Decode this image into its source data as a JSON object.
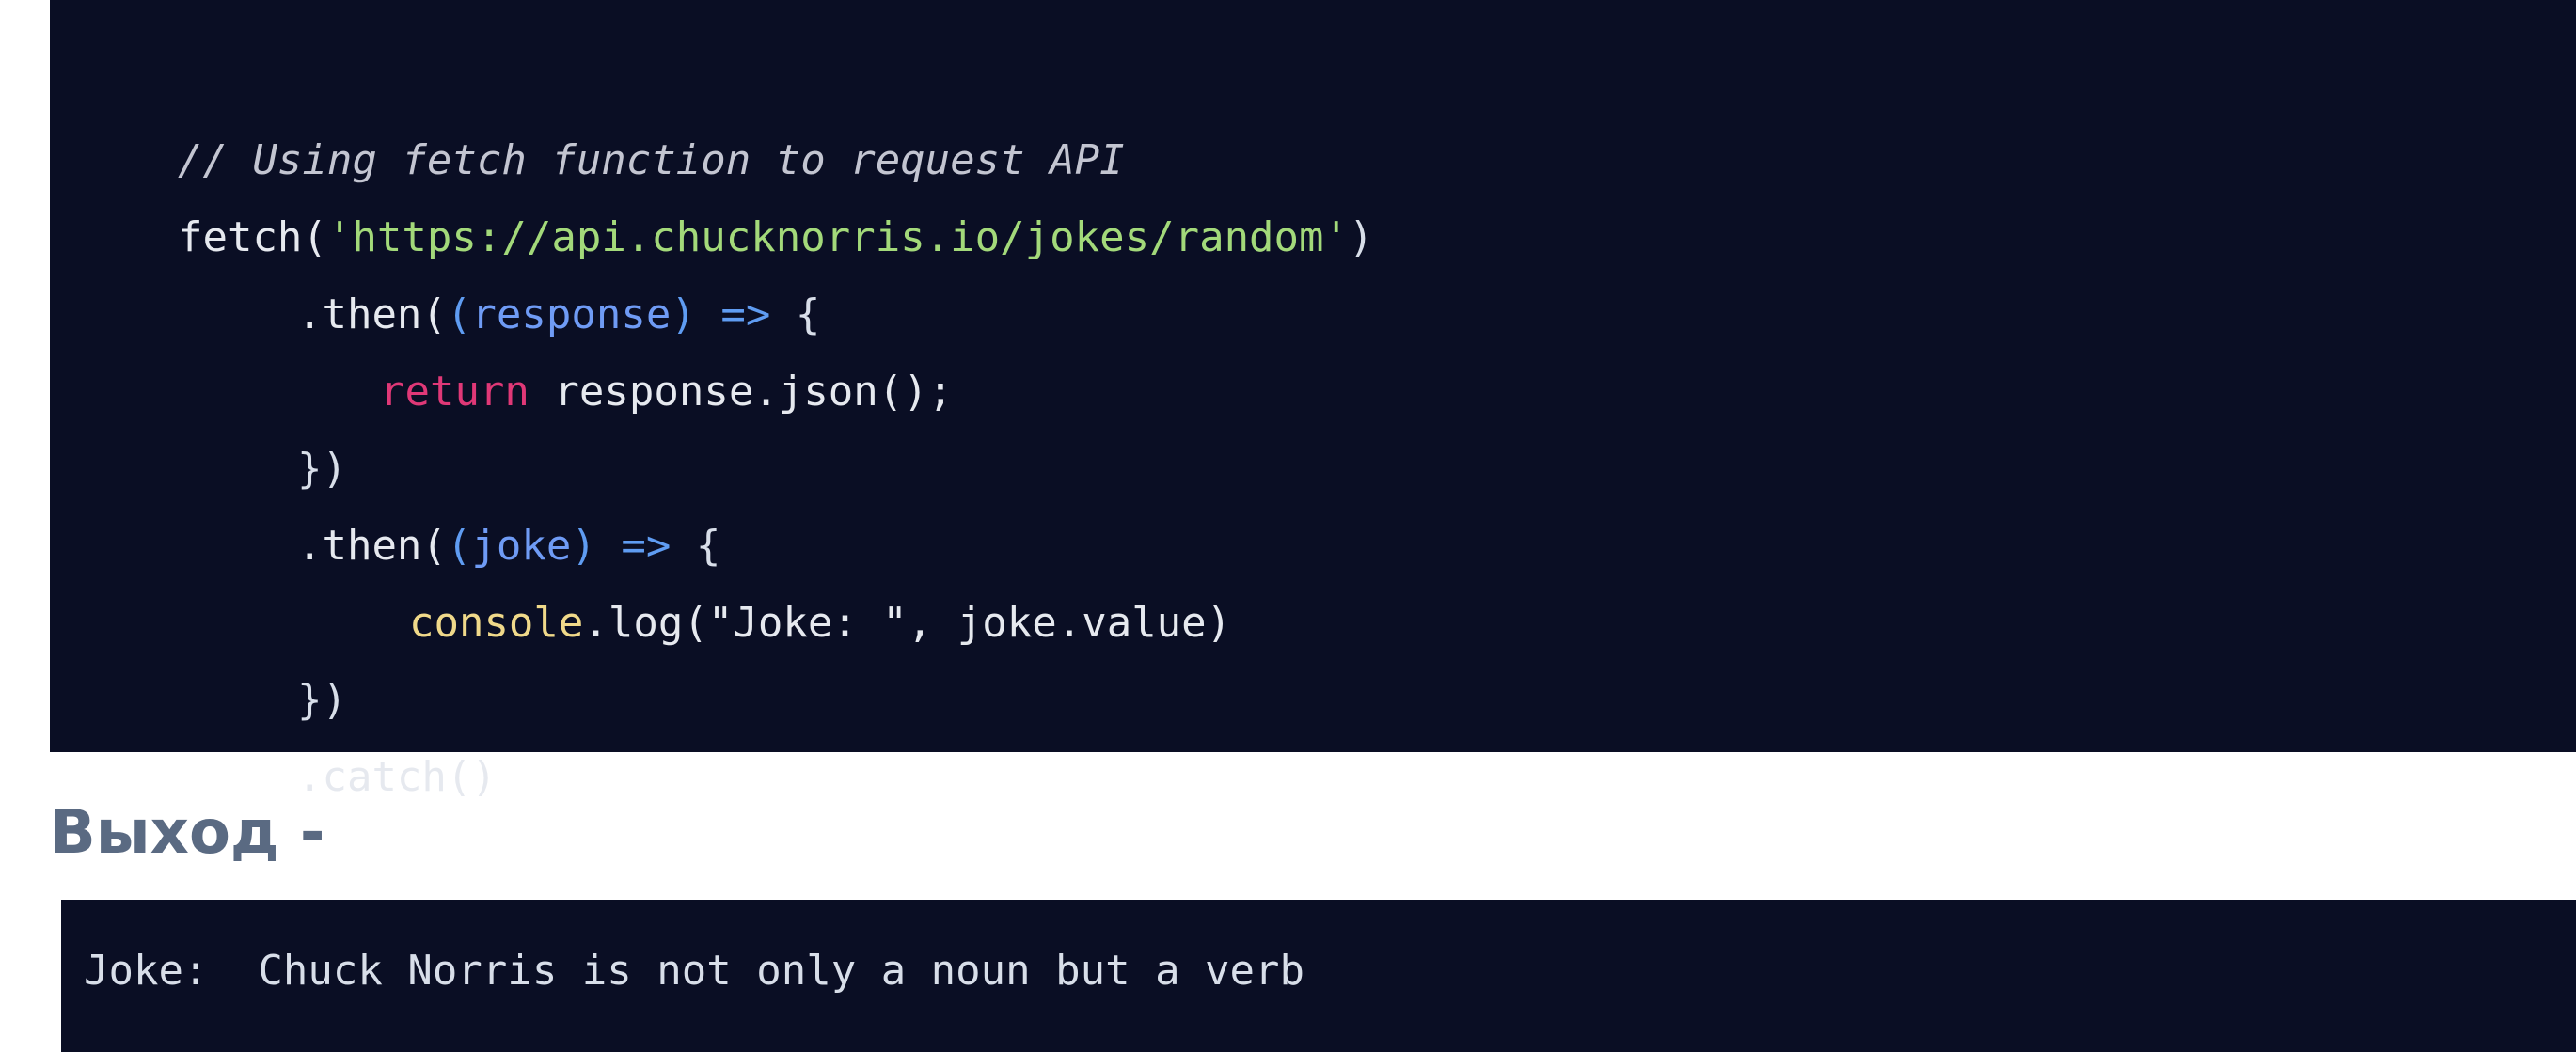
{
  "code": {
    "comment": "// Using fetch function to request API",
    "line2": {
      "fn": "fetch(",
      "url": "'https://api.chucknorris.io/jokes/random'",
      "close": ")"
    },
    "line3": {
      "method": ".then(",
      "open_paren": "(",
      "param": "response",
      "close_paren": ")",
      "arrow": " => ",
      "brace": "{"
    },
    "line4": {
      "keyword": "return",
      "rest": " response.json();"
    },
    "line5": {
      "text": "})"
    },
    "line6": {
      "method": ".then(",
      "open_paren": "(",
      "param": "joke",
      "close_paren": ")",
      "arrow": " => ",
      "brace": "{"
    },
    "line7": {
      "builtin": "console",
      "rest": ".log(\"Joke: \", joke.value)"
    },
    "line8": {
      "text": "})"
    },
    "line9": {
      "text": ".catch()"
    }
  },
  "output": {
    "heading": "Выход -",
    "text": "Joke:  Chuck Norris is not only a noun but a verb"
  },
  "colors": {
    "code_background": "#0a0e24",
    "comment": "#c3c5d1",
    "string": "#a3d97a",
    "parameter": "#6f9bf5",
    "keyword": "#e03877",
    "builtin": "#f0d98a",
    "heading": "#5a6a82"
  }
}
